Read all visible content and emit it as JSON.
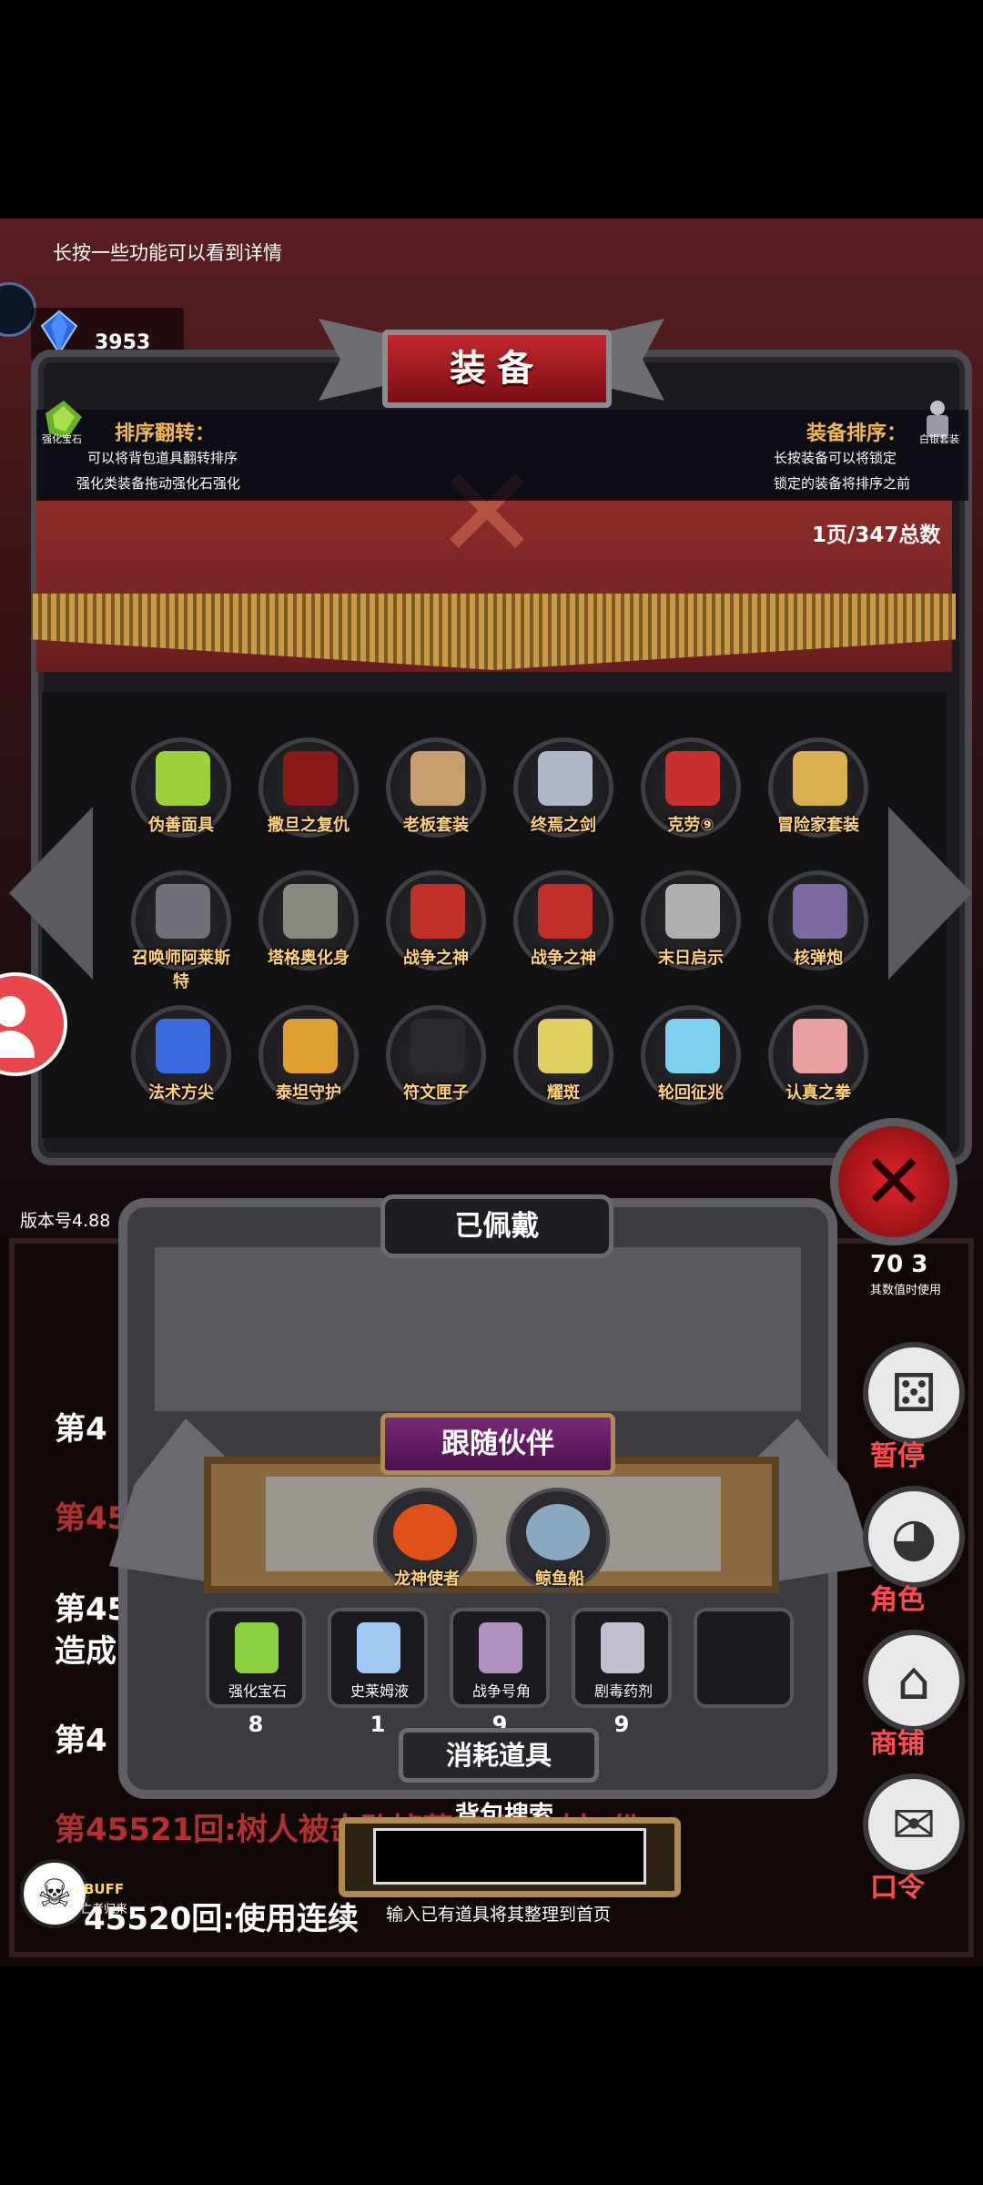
{
  "hint": "长按一些功能可以看到详情",
  "gem": {
    "label": "宝石",
    "count": "3953"
  },
  "title": "装备",
  "info": {
    "left_icon_label": "强化宝石",
    "sort_flip_title": "排序翻转：",
    "sort_flip_line1": "可以将背包道具翻转排序",
    "sort_flip_line2": "强化类装备拖动强化石强化",
    "sort_equip_title": "装备排序：",
    "sort_equip_line1": "长按装备可以将锁定",
    "sort_equip_line2": "锁定的装备将排序之前",
    "right_icon_label": "白银套装"
  },
  "page_info": "1页/347总数",
  "equipment": [
    {
      "name": "伪善面具",
      "icon": "mask-icon",
      "color": "#9bd23c"
    },
    {
      "name": "撒旦之复仇",
      "icon": "demon-wings-icon",
      "color": "#8a1a1a"
    },
    {
      "name": "老板套装",
      "icon": "cowboy-icon",
      "color": "#c8a070"
    },
    {
      "name": "终焉之剑",
      "icon": "sword-icon",
      "color": "#b0b8c8"
    },
    {
      "name": "克劳⑨",
      "icon": "warrior-icon",
      "color": "#c83030"
    },
    {
      "name": "冒险家套装",
      "icon": "adventurer-icon",
      "color": "#d8b050"
    },
    {
      "name": "召唤师阿莱斯特",
      "icon": "summoner-icon",
      "color": "#707078"
    },
    {
      "name": "塔格奥化身",
      "icon": "beast-icon",
      "color": "#8a8a80"
    },
    {
      "name": "战争之神",
      "icon": "war-god-icon",
      "color": "#c03028"
    },
    {
      "name": "战争之神",
      "icon": "war-god-icon",
      "color": "#c03028"
    },
    {
      "name": "末日启示",
      "icon": "axe-icon",
      "color": "#b0b0b0"
    },
    {
      "name": "核弹炮",
      "icon": "cannon-icon",
      "color": "#7a6aa0"
    },
    {
      "name": "法术方尖",
      "icon": "obelisk-icon",
      "color": "#3a6ae0"
    },
    {
      "name": "泰坦守护",
      "icon": "titan-icon",
      "color": "#e0a030"
    },
    {
      "name": "符文匣子",
      "icon": "rune-box-icon",
      "color": "#2a2a2e"
    },
    {
      "name": "耀斑",
      "icon": "flare-sword-icon",
      "color": "#e0d060"
    },
    {
      "name": "轮回征兆",
      "icon": "ice-staff-icon",
      "color": "#80d0f0"
    },
    {
      "name": "认真之拳",
      "icon": "fist-icon",
      "color": "#e8a0a0"
    }
  ],
  "version": "版本号4.88",
  "worn_title": "已佩戴",
  "companion_title": "跟随伙伴",
  "companions": [
    {
      "name": "龙神使者",
      "icon": "dragon-envoy-icon",
      "color": "#e0501a"
    },
    {
      "name": "鲸鱼船",
      "icon": "whale-icon",
      "color": "#8aa8c0"
    }
  ],
  "consumables": [
    {
      "name": "强化宝石",
      "count": "8",
      "icon": "gem-icon",
      "color": "#8ad040"
    },
    {
      "name": "史莱姆液",
      "count": "1",
      "icon": "potion-icon",
      "color": "#a0c8f0"
    },
    {
      "name": "战争号角",
      "count": "9",
      "icon": "horn-icon",
      "color": "#b090c0"
    },
    {
      "name": "剧毒药剂",
      "count": "9",
      "icon": "poison-icon",
      "color": "#c0c0d0"
    },
    {
      "name": "",
      "count": "",
      "icon": "empty-slot-icon",
      "color": "#55555b"
    }
  ],
  "consumables_title": "消耗道具",
  "search": {
    "title": "背包搜索",
    "placeholder": "",
    "hint": "输入已有道具将其整理到首页"
  },
  "side_buttons": [
    {
      "label": "暂停",
      "icon": "dice-icon"
    },
    {
      "label": "角色",
      "icon": "hooded-figure-icon"
    },
    {
      "label": "商铺",
      "icon": "shop-icon"
    },
    {
      "label": "口令",
      "icon": "scroll-icon"
    }
  ],
  "side_counter": {
    "value": "70 3",
    "note": "其数值时使用"
  },
  "log_lines": [
    "第4",
    "第45",
    "第45",
    "造成",
    "第4",
    "第45521回:树人被击败掉落了:灌木材3份",
    "45520回:使用连续"
  ],
  "buff": {
    "label": "BUFF",
    "sub": "亡者归来"
  }
}
